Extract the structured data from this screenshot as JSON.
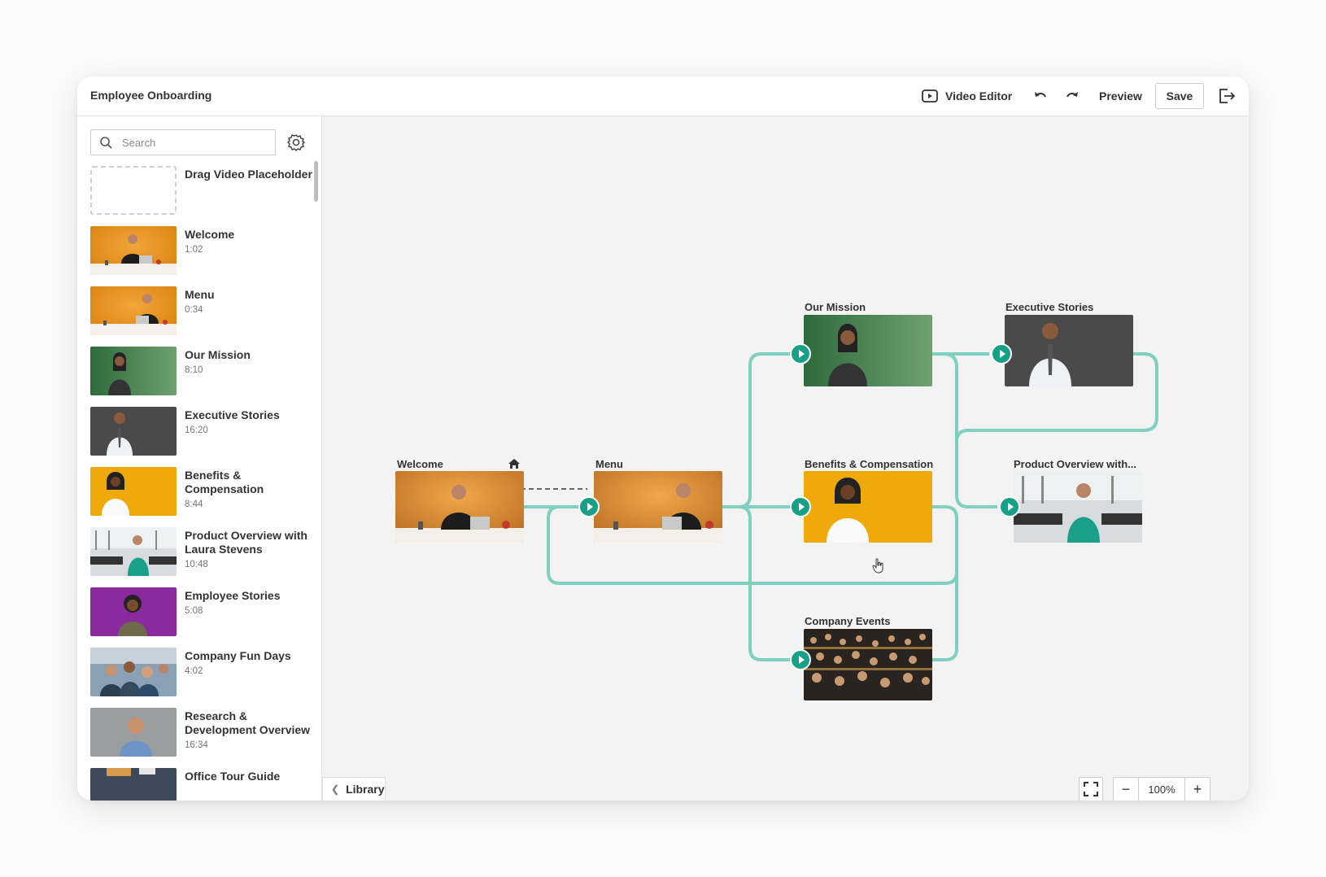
{
  "app": {
    "title": "Employee Onboarding",
    "video_editor_label": "Video Editor",
    "preview_label": "Preview",
    "save_label": "Save"
  },
  "sidebar": {
    "search_placeholder": "Search",
    "placeholder_label": "Drag Video Placeholder",
    "items": [
      {
        "title": "Welcome",
        "duration": "1:02"
      },
      {
        "title": "Menu",
        "duration": "0:34"
      },
      {
        "title": "Our Mission",
        "duration": "8:10"
      },
      {
        "title": "Executive Stories",
        "duration": "16:20"
      },
      {
        "title": "Benefits & Compensation",
        "duration": "8:44"
      },
      {
        "title": "Product Overview with Laura Stevens",
        "duration": "10:48"
      },
      {
        "title": "Employee Stories",
        "duration": "5:08"
      },
      {
        "title": "Company Fun Days",
        "duration": "4:02"
      },
      {
        "title": "Research & Development Overview",
        "duration": "16:34"
      },
      {
        "title": "Office Tour Guide",
        "duration": ""
      }
    ]
  },
  "canvas": {
    "library_label": "Library",
    "zoom_value": "100%",
    "nodes": {
      "welcome": "Welcome",
      "menu": "Menu",
      "our_mission": "Our Mission",
      "executive_stories": "Executive Stories",
      "benefits": "Benefits & Compensation",
      "product_overview": "Product Overview with...",
      "company_events": "Company Events"
    }
  },
  "colors": {
    "accent": "#16a085",
    "connector": "#7fd0bf"
  }
}
